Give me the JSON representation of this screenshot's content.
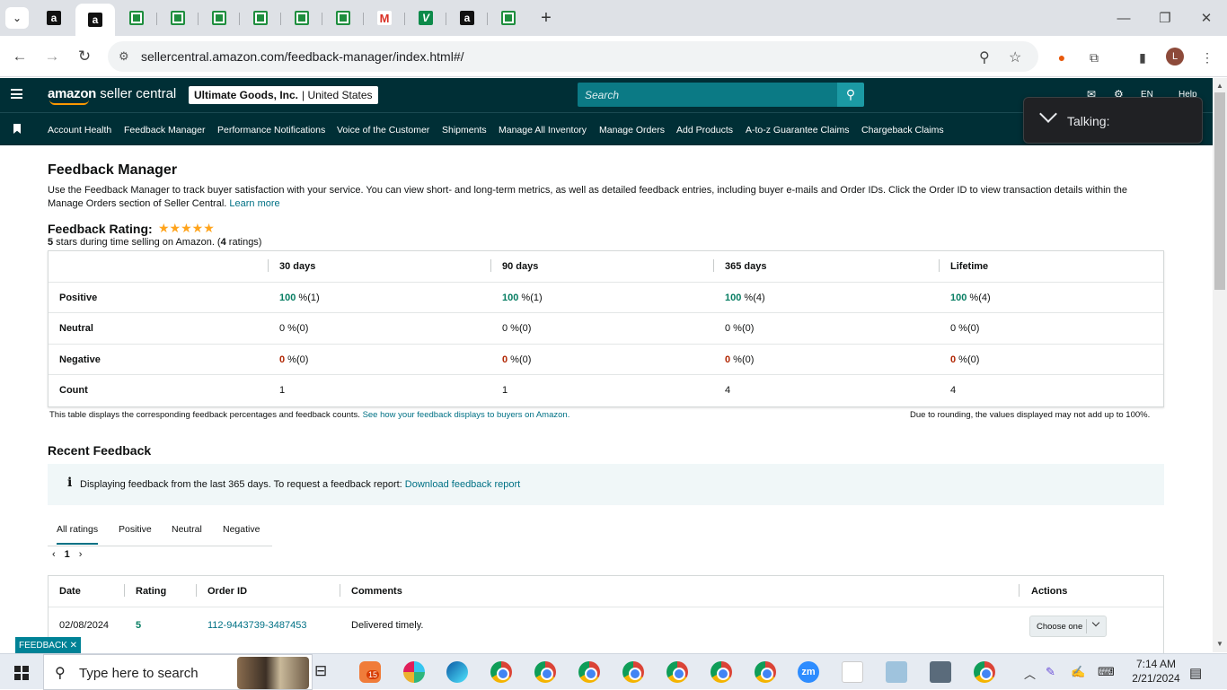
{
  "browser": {
    "url": "sellercentral.amazon.com/feedback-manager/index.html#/",
    "tab_favicons": [
      "amazon",
      "amazon",
      "sheets",
      "sheets",
      "sheets",
      "sheets",
      "sheets",
      "sheets",
      "gmail",
      "v",
      "amazon",
      "sheets"
    ],
    "profile_initial": "L"
  },
  "header": {
    "logo_bold": "amazon",
    "logo_rest": " seller central",
    "store_name": "Ultimate Goods, Inc.",
    "store_region": "United States",
    "search_placeholder": "Search",
    "language": "EN",
    "help": "Help"
  },
  "nav": {
    "items": [
      "Account Health",
      "Feedback Manager",
      "Performance Notifications",
      "Voice of the Customer",
      "Shipments",
      "Manage All Inventory",
      "Manage Orders",
      "Add Products",
      "A-to-z Guarantee Claims",
      "Chargeback Claims"
    ]
  },
  "talking_popup": {
    "label": "Talking:"
  },
  "page": {
    "title": "Feedback Manager",
    "intro": "Use the Feedback Manager to track buyer satisfaction with your service. You can view short- and long-term metrics, as well as detailed feedback entries, including buyer e-mails and Order IDs. Click the Order ID to view transaction details within the Manage Orders section of Seller Central.",
    "learn_more": "Learn more",
    "rating_title": "Feedback Rating:",
    "stars": "★★★★★",
    "rating_count_stars": "5",
    "rating_sub_a": " stars during time selling on Amazon. (",
    "rating_count": "4",
    "rating_sub_b": " ratings)"
  },
  "feedback_table": {
    "columns": [
      "30 days",
      "90 days",
      "365 days",
      "Lifetime"
    ],
    "rows": [
      {
        "label": "Positive",
        "cells": [
          [
            "100",
            " %(1)"
          ],
          [
            "100",
            " %(1)"
          ],
          [
            "100",
            " %(4)"
          ],
          [
            "100",
            " %(4)"
          ]
        ]
      },
      {
        "label": "Neutral",
        "cells": [
          [
            "0",
            " %(0)"
          ],
          [
            "0",
            " %(0)"
          ],
          [
            "0",
            " %(0)"
          ],
          [
            "0",
            " %(0)"
          ]
        ]
      },
      {
        "label": "Negative",
        "cells": [
          [
            "0",
            " %(0)"
          ],
          [
            "0",
            " %(0)"
          ],
          [
            "0",
            " %(0)"
          ],
          [
            "0",
            " %(0)"
          ]
        ]
      },
      {
        "label": "Count",
        "cells": [
          [
            "1",
            ""
          ],
          [
            "1",
            ""
          ],
          [
            "4",
            ""
          ],
          [
            "4",
            ""
          ]
        ]
      }
    ],
    "note_left": "This table displays the corresponding feedback percentages and feedback counts.",
    "note_left_link": "See how your feedback displays to buyers on Amazon.",
    "note_right": "Due to rounding, the values displayed may not add up to 100%."
  },
  "recent": {
    "title": "Recent Feedback",
    "info_icon": "i",
    "info_text": "Displaying feedback from the last 365 days. To request a feedback report:",
    "info_link": "Download feedback report",
    "tabs": [
      "All ratings",
      "Positive",
      "Neutral",
      "Negative"
    ],
    "page": "1",
    "columns": [
      "Date",
      "Rating",
      "Order ID",
      "Comments",
      "Actions"
    ],
    "rows": [
      {
        "date": "02/08/2024",
        "rating": "5",
        "order_id": "112-9443739-3487453",
        "comment": "Delivered timely.",
        "action": "Choose one"
      }
    ]
  },
  "feedback_button": "FEEDBACK ✕",
  "taskbar": {
    "search_placeholder": "Type here to search",
    "badge": "15",
    "zoom": "zm",
    "time": "7:14 AM",
    "date": "2/21/2024"
  },
  "colors": {
    "header_bg": "#002f36",
    "positive": "#067d62",
    "negative": "#b12704",
    "link": "#007185"
  }
}
